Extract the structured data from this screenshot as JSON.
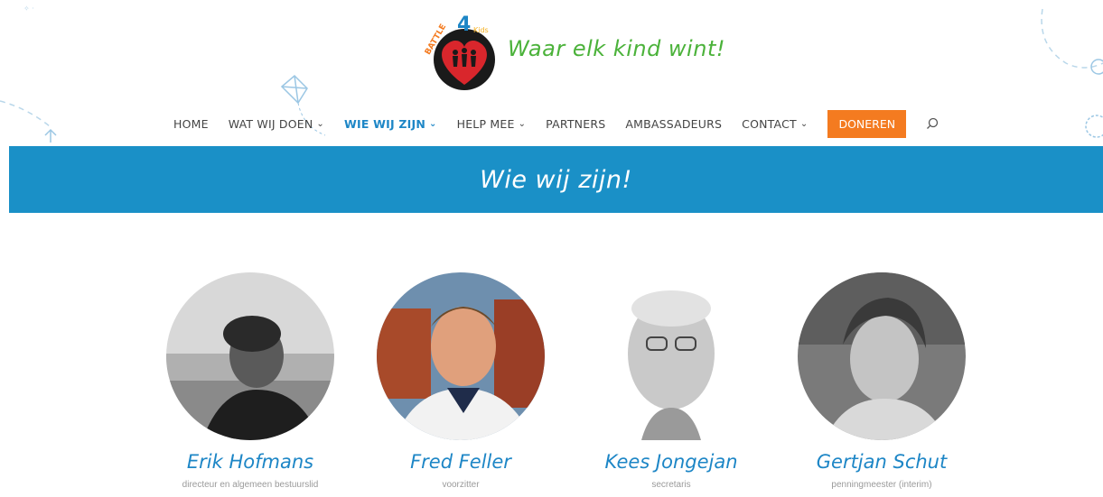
{
  "header": {
    "logo_text": "BATTLE4Kids",
    "tagline": "Waar elk kind wint!"
  },
  "nav": {
    "items": [
      {
        "label": "HOME",
        "dropdown": false,
        "active": false
      },
      {
        "label": "WAT WIJ DOEN",
        "dropdown": true,
        "active": false
      },
      {
        "label": "WIE WIJ ZIJN",
        "dropdown": true,
        "active": true
      },
      {
        "label": "HELP MEE",
        "dropdown": true,
        "active": false
      },
      {
        "label": "PARTNERS",
        "dropdown": false,
        "active": false
      },
      {
        "label": "AMBASSADEURS",
        "dropdown": false,
        "active": false
      },
      {
        "label": "CONTACT",
        "dropdown": true,
        "active": false
      }
    ],
    "donate_label": "DONEREN",
    "search_icon": "search-icon"
  },
  "banner": {
    "title": "Wie wij zijn!"
  },
  "team": [
    {
      "name": "Erik Hofmans",
      "role": "directeur en algemeen bestuurslid"
    },
    {
      "name": "Fred Feller",
      "role": "voorzitter"
    },
    {
      "name": "Kees Jongejan",
      "role": "secretaris"
    },
    {
      "name": "Gertjan Schut",
      "role": "penningmeester (interim)"
    }
  ],
  "colors": {
    "accent_blue": "#1a90c7",
    "link_blue": "#1d86c6",
    "donate_orange": "#f47b20",
    "tagline_green": "#4bb23a",
    "logo_red": "#d9262c"
  }
}
